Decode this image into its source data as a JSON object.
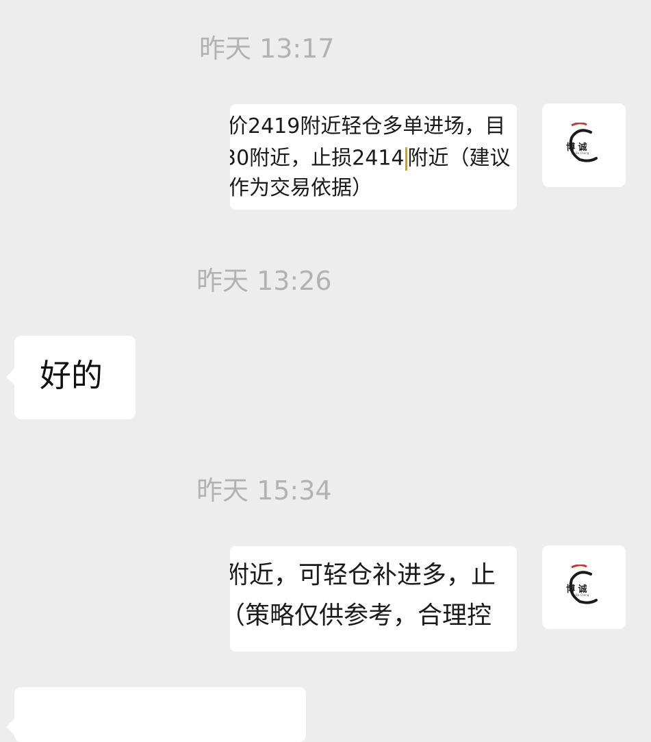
{
  "messages": [
    {
      "timestamp": "昨天 13:17",
      "image_lines": {
        "l1": "价2419附近轻仓多单进场，目",
        "l2a": "30附近，止损2414",
        "l2b": "附近（建议",
        "l3": "作为交易依据）"
      },
      "avatar_text": "博 诚"
    },
    {
      "timestamp": "昨天 13:26",
      "bubble_text": "好的"
    },
    {
      "timestamp": "昨天 15:34",
      "image_lines": {
        "l1": "附近，可轻仓补进多，止",
        "l2": "（策略仅供参考，合理控"
      },
      "avatar_text": "博 诚"
    }
  ],
  "colors": {
    "background": "#ededed",
    "timestamp": "#b2b2b2",
    "bubble": "#ffffff",
    "logo_red": "#c0392b"
  },
  "icons": {
    "avatar_logo": "bocheng-logo-icon"
  }
}
